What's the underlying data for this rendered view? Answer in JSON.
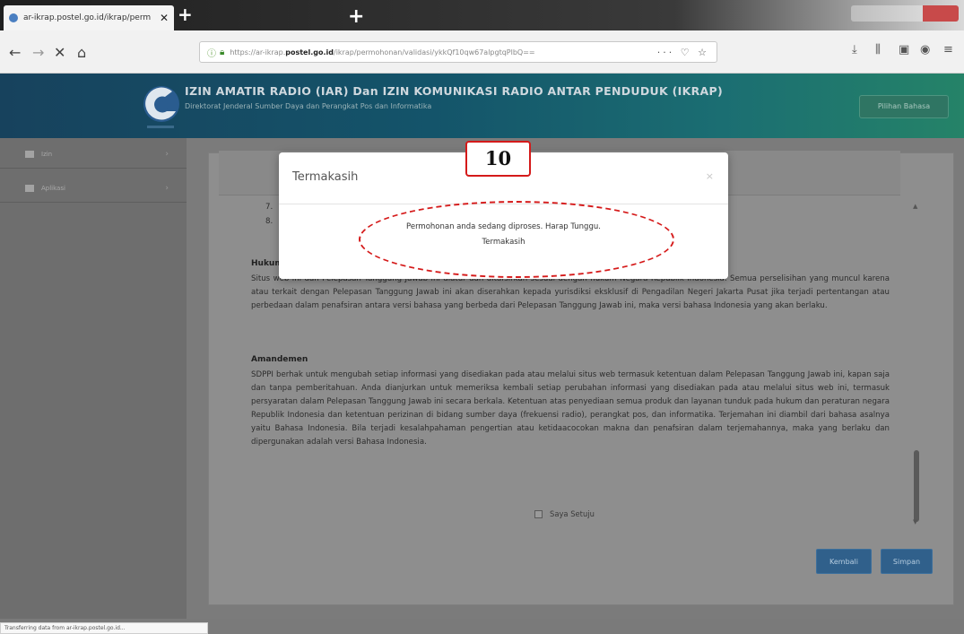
{
  "browser": {
    "tab_title": "ar-ikrap.postel.go.id/ikrap/perm",
    "url_prefix": "https://ar-ikrap.",
    "url_domain": "postel.go.id",
    "url_path": "/ikrap/permohonan/validasi/ykkQf10qw67alpgtqPlbQ==",
    "url_actions": "··· ♡ ☆"
  },
  "site": {
    "title": "IZIN AMATIR RADIO (IAR) Dan IZIN KOMUNIKASI RADIO ANTAR PENDUDUK (IKRAP)",
    "subtitle": "Direktorat Jenderal Sumber Daya dan Perangkat Pos dan Informatika",
    "header_button": "Pilihan Bahasa"
  },
  "sidebar": {
    "items": [
      {
        "label": "Izin"
      },
      {
        "label": "Aplikasi"
      }
    ]
  },
  "content": {
    "list_numbers": [
      "7.",
      "8."
    ],
    "section1_heading": "Hukum",
    "section1_text": "Situs web ini dan Pelepasan Tanggung Jawab ini diatur dan ditafsirkan sesuai dengan hukum Negara Republik Indonesia. Semua perselisihan yang muncul karena atau terkait dengan Pelepasan Tanggung Jawab ini akan diserahkan kepada yurisdiksi eksklusif di Pengadilan Negeri Jakarta Pusat jika terjadi pertentangan atau perbedaan dalam penafsiran antara versi bahasa yang berbeda dari Pelepasan Tanggung Jawab ini, maka versi bahasa Indonesia yang akan berlaku.",
    "section2_heading": "Amandemen",
    "section2_text": "SDPPI berhak untuk mengubah setiap informasi yang disediakan pada atau melalui situs web termasuk ketentuan dalam Pelepasan Tanggung Jawab ini, kapan saja dan tanpa pemberitahuan. Anda dianjurkan untuk memeriksa kembali setiap perubahan informasi yang disediakan pada atau melalui situs web ini, termasuk persyaratan dalam Pelepasan Tanggung Jawab ini secara berkala. Ketentuan atas penyediaan semua produk dan layanan tunduk pada hukum dan peraturan negara Republik Indonesia dan ketentuan perizinan di bidang sumber daya (frekuensi radio), perangkat pos, dan informatika. Terjemahan ini diambil dari bahasa asalnya yaitu Bahasa Indonesia. Bila terjadi kesalahpahaman pengertian atau ketidaacocokan makna dan penafsiran dalam terjemahannya, maka yang berlaku dan dipergunakan adalah versi Bahasa Indonesia.",
    "agree_label": "Saya Setuju",
    "back_button": "Kembali",
    "next_button": "Simpan"
  },
  "modal": {
    "title": "Termakasih",
    "close_symbol": "×",
    "message_line1": "Permohonan anda sedang diproses. Harap Tunggu.",
    "message_line2": "Termakasih"
  },
  "annotation": {
    "step_number": "10",
    "color": "#d41a1a"
  },
  "status_tip": "Transferring data from ar-ikrap.postel.go.id..."
}
